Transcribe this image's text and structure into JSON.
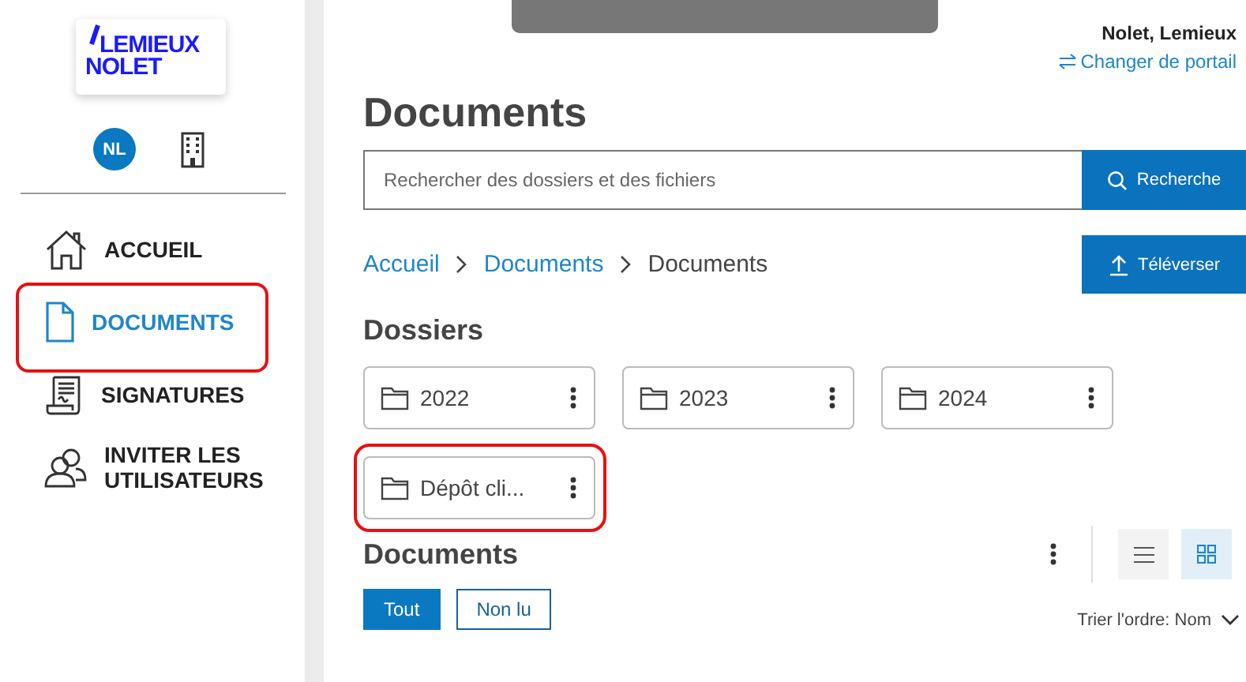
{
  "logo": {
    "line_1": "LEMIEUX",
    "line_2": "NOLET"
  },
  "user": {
    "initials": "NL",
    "name": "Nolet, Lemieux",
    "switch_link": "Changer de portail"
  },
  "sidebar": {
    "items": [
      {
        "kind": "home",
        "label": "ACCUEIL",
        "selected": false,
        "highlighted": false
      },
      {
        "kind": "document",
        "label": "DOCUMENTS",
        "selected": true,
        "highlighted": true
      },
      {
        "kind": "signature",
        "label": "SIGNATURES",
        "selected": false,
        "highlighted": false
      },
      {
        "kind": "users",
        "label": "INVITER LES UTILISATEURS",
        "selected": false,
        "highlighted": false
      }
    ]
  },
  "page_title": "Documents",
  "search": {
    "placeholder": "Rechercher des dossiers et des fichiers",
    "button": "Recherche"
  },
  "breadcrumb": [
    "Accueil",
    "Documents",
    "Documents"
  ],
  "upload_button": "Téléverser",
  "folders_heading": "Dossiers",
  "folders": [
    {
      "name": "2022",
      "highlighted": false
    },
    {
      "name": "2023",
      "highlighted": false
    },
    {
      "name": "2024",
      "highlighted": false
    },
    {
      "name": "Dépôt cli...",
      "highlighted": true
    }
  ],
  "documents_heading": "Documents",
  "view_toggles": [
    {
      "kind": "list",
      "selected": false
    },
    {
      "kind": "grid",
      "selected": true
    }
  ],
  "filters": [
    {
      "label": "Tout",
      "selected": true
    },
    {
      "label": "Non lu",
      "selected": false
    }
  ],
  "sort_label": "Trier l'ordre: Nom"
}
